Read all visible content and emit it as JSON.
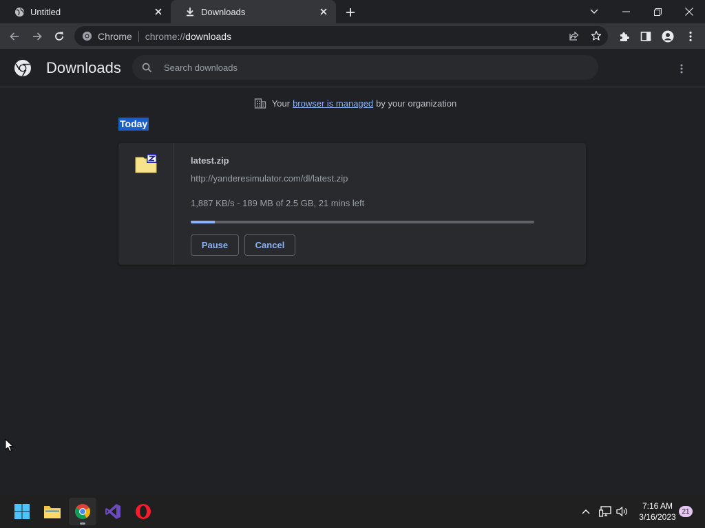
{
  "tabs": [
    {
      "title": "Untitled",
      "icon": "globe-icon",
      "active": false
    },
    {
      "title": "Downloads",
      "icon": "download-icon",
      "active": true
    }
  ],
  "toolbar": {
    "site_label": "Chrome",
    "url_scheme": "chrome://",
    "url_path": "downloads"
  },
  "downloads_page": {
    "title": "Downloads",
    "search_placeholder": "Search downloads",
    "managed_prefix": "Your",
    "managed_link": "browser is managed",
    "managed_suffix": "by your organization",
    "group_label": "Today",
    "items": [
      {
        "filename": "latest.zip",
        "url": "http://yanderesimulator.com/dl/latest.zip",
        "status": "1,887 KB/s - 189 MB of 2.5 GB, 21 mins left",
        "progress_fraction": 0.07,
        "pause_label": "Pause",
        "cancel_label": "Cancel"
      }
    ]
  },
  "taskbar": {
    "time": "7:16 AM",
    "date": "3/16/2023",
    "notification_count": "21"
  },
  "colors": {
    "accent": "#8ab4f8",
    "selection": "#1a5fc9",
    "background": "#202124"
  }
}
